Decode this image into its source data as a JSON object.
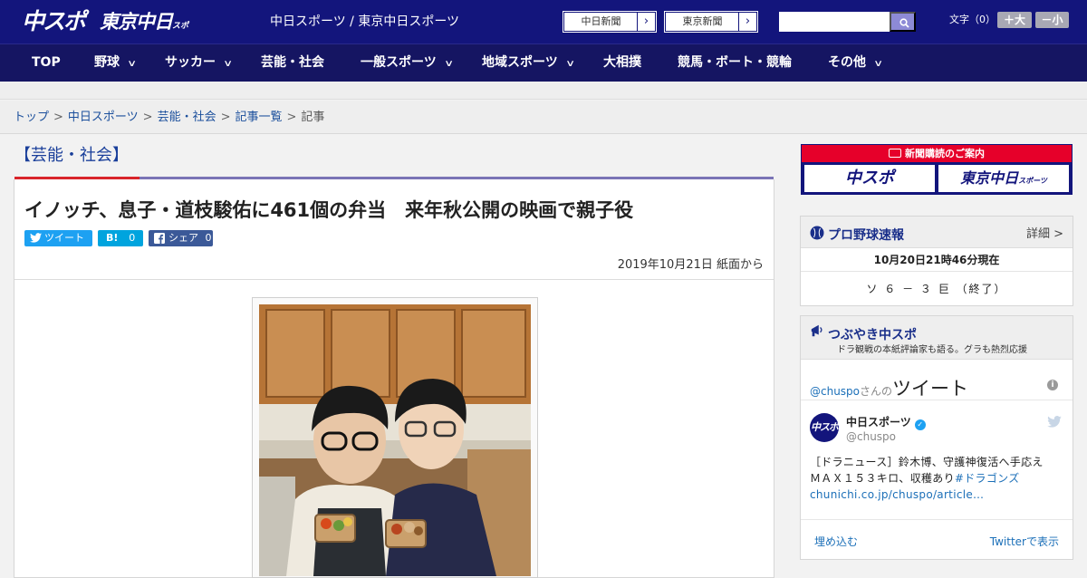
{
  "header": {
    "logo_chuspo": "中スポ",
    "logo_tokyo": "東京中日",
    "logo_tokyo_small": "スポーツ",
    "site_name": "中日スポーツ / 東京中日スポーツ",
    "ext_links": [
      {
        "label": "中日新聞"
      },
      {
        "label": "東京新聞"
      }
    ],
    "arrow_glyph": "›",
    "search_placeholder": "",
    "font_size_label": "文字（0）",
    "font_plus": "＋大",
    "font_minus": "－小"
  },
  "nav": {
    "items": [
      {
        "label": "TOP",
        "has_dropdown": false
      },
      {
        "label": "野球",
        "has_dropdown": true
      },
      {
        "label": "サッカー",
        "has_dropdown": true
      },
      {
        "label": "芸能・社会",
        "has_dropdown": false
      },
      {
        "label": "一般スポーツ",
        "has_dropdown": true
      },
      {
        "label": "地域スポーツ",
        "has_dropdown": true
      },
      {
        "label": "大相撲",
        "has_dropdown": false
      },
      {
        "label": "競馬・ボート・競輪",
        "has_dropdown": false
      },
      {
        "label": "その他",
        "has_dropdown": true
      }
    ],
    "chevron": "∨"
  },
  "breadcrumb": {
    "items": [
      "トップ",
      "中日スポーツ",
      "芸能・社会",
      "記事一覧"
    ],
    "current": "記事",
    "separator": ">"
  },
  "article": {
    "section": "【芸能・社会】",
    "headline": "イノッチ、息子・道枝駿佑に461個の弁当　来年秋公開の映画で親子役",
    "share": {
      "tweet": "ツイート",
      "hatena_label": "B!",
      "hatena_count": "0",
      "facebook": "シェア",
      "facebook_count": "0"
    },
    "date": "2019年10月21日 紙面から"
  },
  "sidebar": {
    "subscribe": {
      "title": "新聞購読のご案内",
      "chuspo": "中スポ",
      "tokyo": "東京中日",
      "tokyo_small": "スポーツ"
    },
    "baseball": {
      "title": "プロ野球速報",
      "more": "詳細 >",
      "time": "10月20日21時46分現在",
      "score": "ソ ６ － ３ 巨 （終了）"
    },
    "tweets": {
      "title": "つぶやき中スポ",
      "subtitle": "ドラ観戦の本紙評論家も語る。グラも熱烈応援",
      "header_handle": "@chuspo",
      "header_mid": "さんの",
      "header_big": "ツイート",
      "info": "i",
      "account_name": "中日スポーツ",
      "verified": "✓",
      "account_handle": "@chuspo",
      "avatar_text": "中スポ",
      "text_plain": "［ドラニュース］鈴木博、守護神復活へ手応え　ＭＡＸ１５３キロ、収穫あり",
      "text_hashtag": "#ドラゴンズ",
      "text_link": "chunichi.co.jp/chuspo/article…",
      "embed": "埋め込む",
      "view_on_twitter": "Twitterで表示"
    }
  },
  "colors": {
    "header_bg": "#13157c",
    "nav_bg": "#151562",
    "accent_red": "#d9252b",
    "link_blue": "#1b4f9c",
    "twitter_blue": "#1da1f2",
    "hatena_blue": "#00a4de",
    "facebook_blue": "#3b5998"
  },
  "icons": {
    "search": "search-icon",
    "twitter": "twitter-bird-icon",
    "facebook": "facebook-icon",
    "baseball": "baseball-icon",
    "megaphone": "megaphone-icon",
    "newspaper": "newspaper-icon"
  }
}
